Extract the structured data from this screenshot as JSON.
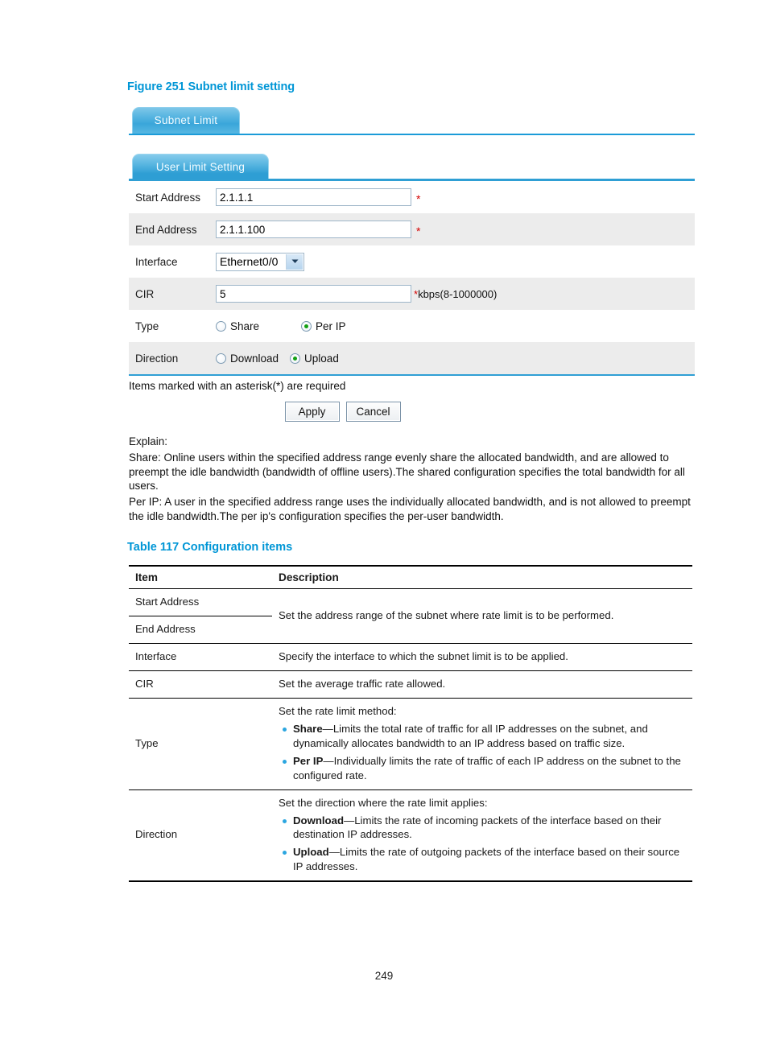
{
  "figure": {
    "caption": "Figure 251 Subnet limit setting"
  },
  "screenshot": {
    "outer_tab": "Subnet Limit",
    "inner_tab": "User Limit Setting",
    "form": {
      "start_address": {
        "label": "Start Address",
        "value": "2.1.1.1",
        "required_mark": "*"
      },
      "end_address": {
        "label": "End Address",
        "value": "2.1.1.100",
        "required_mark": "*"
      },
      "interface": {
        "label": "Interface",
        "selected": "Ethernet0/0",
        "options": [
          "Ethernet0/0"
        ]
      },
      "cir": {
        "label": "CIR",
        "value": "5",
        "hint_star": "*",
        "hint": "kbps(8-1000000)"
      },
      "type": {
        "label": "Type",
        "options": [
          {
            "label": "Share",
            "selected": false
          },
          {
            "label": "Per IP",
            "selected": true
          }
        ]
      },
      "direction": {
        "label": "Direction",
        "options": [
          {
            "label": "Download",
            "selected": false
          },
          {
            "label": "Upload",
            "selected": true
          }
        ]
      }
    },
    "required_note": "Items marked with an asterisk(*) are required",
    "buttons": {
      "apply": "Apply",
      "cancel": "Cancel"
    },
    "explain": {
      "heading": "Explain:",
      "share": "Share: Online users within the specified address range evenly share the allocated bandwidth, and are allowed to preempt the idle bandwidth (bandwidth of offline users).The shared configuration specifies the total bandwidth for all users.",
      "per_ip": "Per IP: A user in the specified address range uses the individually allocated bandwidth, and is not allowed to preempt the idle bandwidth.The per ip's configuration specifies the per-user bandwidth."
    }
  },
  "table": {
    "caption": "Table 117 Configuration items",
    "headers": {
      "item": "Item",
      "description": "Description"
    },
    "rows": {
      "start_address": "Start Address",
      "end_address": "End Address",
      "address_range_desc": "Set the address range of the subnet where rate limit is to be performed.",
      "interface": "Interface",
      "interface_desc": "Specify the interface to which the subnet limit is to be applied.",
      "cir": "CIR",
      "cir_desc": "Set the average traffic rate allowed.",
      "type": "Type",
      "type_intro": "Set the rate limit method:",
      "type_bullet1_bold": "Share",
      "type_bullet1_text": "—Limits the total rate of traffic for all IP addresses on the subnet, and dynamically allocates bandwidth to an IP address based on traffic size.",
      "type_bullet2_bold": "Per IP",
      "type_bullet2_text": "—Individually limits the rate of traffic of each IP address on the subnet to the configured rate.",
      "direction": "Direction",
      "direction_intro": "Set the direction where the rate limit applies:",
      "direction_bullet1_bold": "Download",
      "direction_bullet1_text": "—Limits the rate of incoming packets of the interface based on their destination IP addresses.",
      "direction_bullet2_bold": "Upload",
      "direction_bullet2_text": "—Limits the rate of outgoing packets of the interface based on their source IP addresses."
    }
  },
  "footer": {
    "page_number": "249"
  },
  "colors": {
    "accent_blue": "#0096d6",
    "tab_blue": "#3aa6da",
    "rule_blue": "#2f9fd4",
    "bullet_blue": "#2ba6e0",
    "required_red": "#d40000",
    "radio_green": "#13a014",
    "row_alt": "#ececec"
  }
}
